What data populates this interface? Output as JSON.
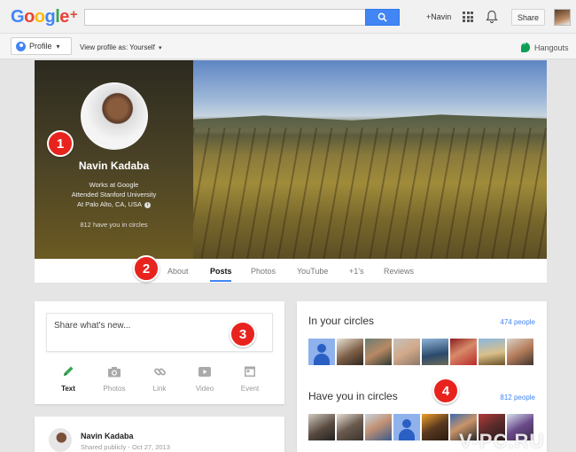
{
  "topbar": {
    "logo_letters": [
      {
        "ch": "G",
        "color": "#4285f4"
      },
      {
        "ch": "o",
        "color": "#ea4335"
      },
      {
        "ch": "o",
        "color": "#fbbc05"
      },
      {
        "ch": "g",
        "color": "#4285f4"
      },
      {
        "ch": "l",
        "color": "#34a853"
      },
      {
        "ch": "e",
        "color": "#ea4335"
      },
      {
        "ch": "+",
        "color": "#dd4b39"
      }
    ],
    "search_placeholder": "",
    "user_link": "+Navin",
    "share_label": "Share"
  },
  "subbar": {
    "profile_label": "Profile",
    "view_as": "View profile as: Yourself",
    "hangouts_label": "Hangouts"
  },
  "cover": {
    "name": "Navin Kadaba",
    "line1": "Works at Google",
    "line2": "Attended Stanford University",
    "line3": "At Palo Alto, CA, USA",
    "circles": "812 have you in circles"
  },
  "badges": [
    "1",
    "2",
    "3",
    "4"
  ],
  "tabs": [
    {
      "label": "About",
      "active": false
    },
    {
      "label": "Posts",
      "active": true
    },
    {
      "label": "Photos",
      "active": false
    },
    {
      "label": "YouTube",
      "active": false
    },
    {
      "label": "+1's",
      "active": false
    },
    {
      "label": "Reviews",
      "active": false
    }
  ],
  "share": {
    "prompt": "Share what's new...",
    "actions": [
      {
        "label": "Text",
        "icon": "pencil-icon",
        "active": true
      },
      {
        "label": "Photos",
        "icon": "camera-icon",
        "active": false
      },
      {
        "label": "Link",
        "icon": "link-icon",
        "active": false
      },
      {
        "label": "Video",
        "icon": "video-icon",
        "active": false
      },
      {
        "label": "Event",
        "icon": "calendar-icon",
        "active": false
      }
    ]
  },
  "post": {
    "name": "Navin Kadaba",
    "meta": "Shared publicly  -  Oct 27, 2013"
  },
  "circles": {
    "in_your_title": "In your circles",
    "in_your_count": "474 people",
    "have_you_title": "Have you in circles",
    "have_you_count": "812 people"
  },
  "colors": {
    "accent": "#4285f4",
    "badge": "#e8231e"
  },
  "watermark": "V-PC.RU"
}
